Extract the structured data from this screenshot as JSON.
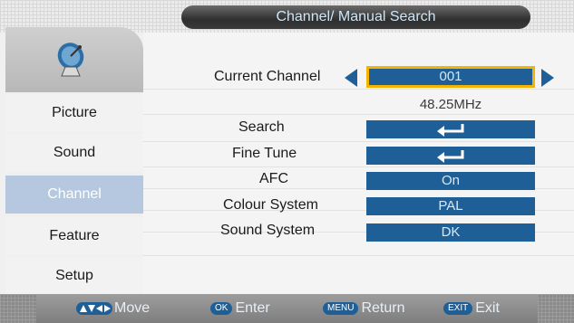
{
  "title": "Channel/ Manual Search",
  "sidebar": {
    "items": [
      {
        "label": "Picture"
      },
      {
        "label": "Sound"
      },
      {
        "label": "Channel"
      },
      {
        "label": "Feature"
      },
      {
        "label": "Setup"
      }
    ],
    "active_index": 2
  },
  "settings": {
    "current_channel": {
      "label": "Current Channel",
      "value": "001"
    },
    "frequency": "48.25MHz",
    "search": {
      "label": "Search"
    },
    "fine_tune": {
      "label": "Fine Tune"
    },
    "afc": {
      "label": "AFC",
      "value": "On"
    },
    "colour_system": {
      "label": "Colour System",
      "value": "PAL"
    },
    "sound_system": {
      "label": "Sound System",
      "value": "DK"
    }
  },
  "footer": {
    "move": {
      "label": "Move"
    },
    "enter": {
      "key": "OK",
      "label": "Enter"
    },
    "return": {
      "key": "MENU",
      "label": "Return"
    },
    "exit": {
      "key": "EXIT",
      "label": "Exit"
    }
  },
  "colors": {
    "accent": "#1f5f97",
    "active_sidebar": "#b5c8e0",
    "selection_border": "#f2b400"
  },
  "icons": [
    "satellite-dish-icon",
    "enter-icon",
    "left-arrow-icon",
    "right-arrow-icon",
    "direction-keys-icon"
  ]
}
